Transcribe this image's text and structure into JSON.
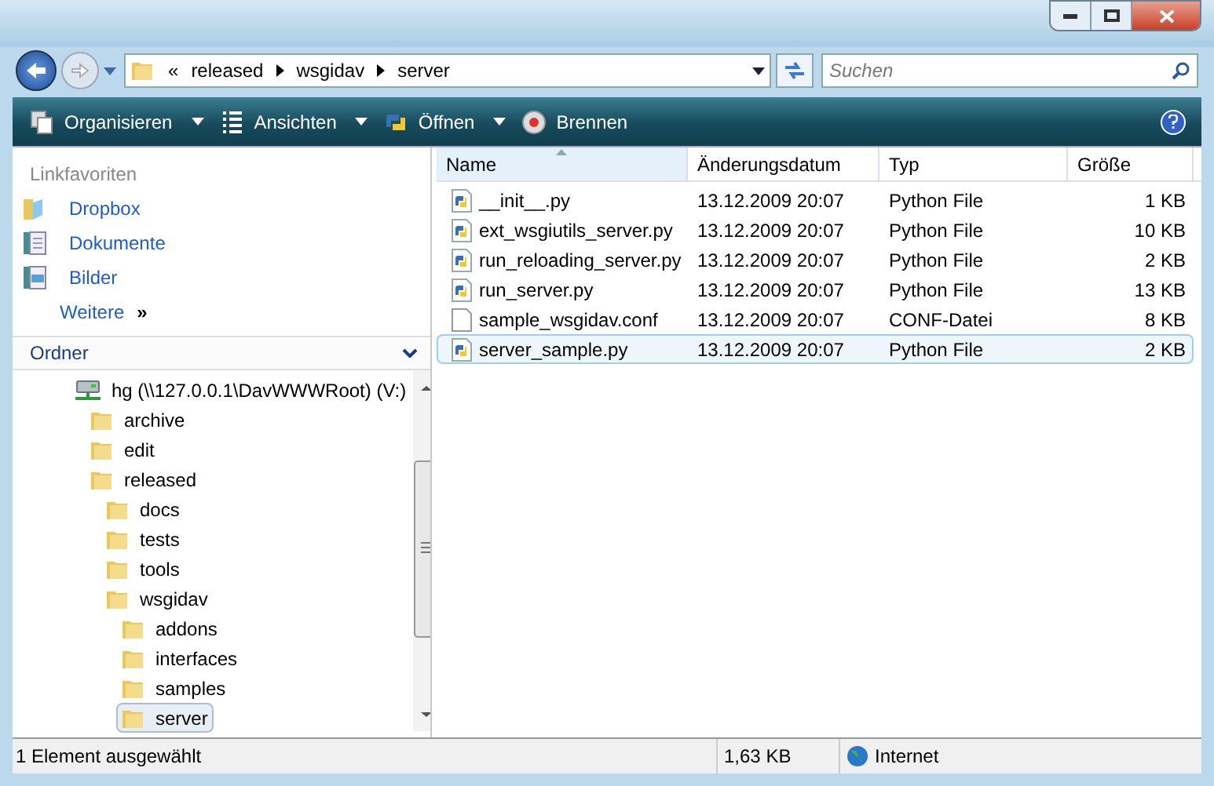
{
  "address": {
    "overflow": "«",
    "crumbs": [
      "released",
      "wsgidav",
      "server"
    ]
  },
  "search": {
    "placeholder": "Suchen"
  },
  "toolbar": [
    {
      "label": "Organisieren",
      "dropdown": true
    },
    {
      "label": "Ansichten",
      "dropdown": true
    },
    {
      "label": "Öffnen",
      "dropdown": true
    },
    {
      "label": "Brennen",
      "dropdown": false
    }
  ],
  "favorites": {
    "title": "Linkfavoriten",
    "items": [
      {
        "label": "Dropbox"
      },
      {
        "label": "Dokumente"
      },
      {
        "label": "Bilder"
      }
    ],
    "more": "Weitere",
    "more_glyph": "»"
  },
  "folders": {
    "title": "Ordner",
    "tree": [
      {
        "label": "hg (\\\\127.0.0.1\\DavWWWRoot) (V:)",
        "kind": "drive",
        "selected": false,
        "children": [
          {
            "label": "archive",
            "kind": "folder",
            "selected": false
          },
          {
            "label": "edit",
            "kind": "folder",
            "selected": false
          },
          {
            "label": "released",
            "kind": "folder",
            "selected": false,
            "children": [
              {
                "label": "docs",
                "kind": "folder",
                "selected": false
              },
              {
                "label": "tests",
                "kind": "folder",
                "selected": false
              },
              {
                "label": "tools",
                "kind": "folder",
                "selected": false
              },
              {
                "label": "wsgidav",
                "kind": "folder",
                "selected": false,
                "children": [
                  {
                    "label": "addons",
                    "kind": "folder",
                    "selected": false
                  },
                  {
                    "label": "interfaces",
                    "kind": "folder",
                    "selected": false
                  },
                  {
                    "label": "samples",
                    "kind": "folder",
                    "selected": false
                  },
                  {
                    "label": "server",
                    "kind": "folder",
                    "selected": true
                  }
                ]
              }
            ]
          }
        ]
      }
    ]
  },
  "table": {
    "columns": [
      "Name",
      "Änderungsdatum",
      "Typ",
      "Größe"
    ],
    "rows": [
      {
        "name": "__init__.py",
        "date": "13.12.2009 20:07",
        "type": "Python File",
        "size": "1 KB",
        "kind": "python",
        "selected": false
      },
      {
        "name": "ext_wsgiutils_server.py",
        "date": "13.12.2009 20:07",
        "type": "Python File",
        "size": "10 KB",
        "kind": "python",
        "selected": false
      },
      {
        "name": "run_reloading_server.py",
        "date": "13.12.2009 20:07",
        "type": "Python File",
        "size": "2 KB",
        "kind": "python",
        "selected": false
      },
      {
        "name": "run_server.py",
        "date": "13.12.2009 20:07",
        "type": "Python File",
        "size": "13 KB",
        "kind": "python",
        "selected": false
      },
      {
        "name": "sample_wsgidav.conf",
        "date": "13.12.2009 20:07",
        "type": "CONF-Datei",
        "size": "8 KB",
        "kind": "file",
        "selected": false
      },
      {
        "name": "server_sample.py",
        "date": "13.12.2009 20:07",
        "type": "Python File",
        "size": "2 KB",
        "kind": "python",
        "selected": true
      }
    ]
  },
  "status_bar": {
    "selection": "1 Element ausgewählt",
    "size": "1,63 KB",
    "zone": "Internet"
  }
}
